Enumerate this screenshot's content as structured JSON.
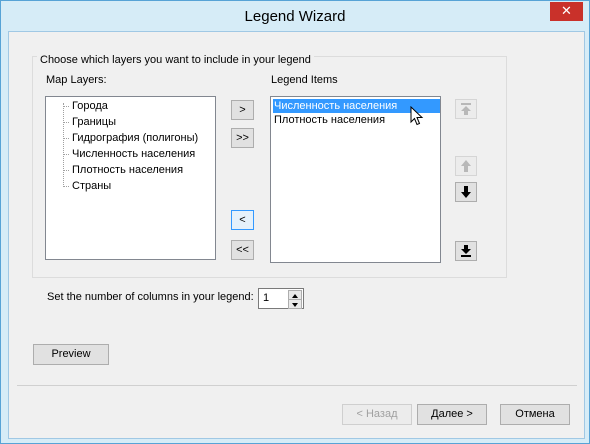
{
  "window": {
    "title": "Legend Wizard",
    "close_glyph": "✕"
  },
  "group": {
    "title": "Choose which layers you want to include in your legend"
  },
  "map_layers": {
    "label": "Map Layers:",
    "items": [
      "Города",
      "Границы",
      "Гидрография (полигоны)",
      "Численность населения",
      "Плотность населения",
      "Страны"
    ]
  },
  "legend_items": {
    "label": "Legend Items",
    "items": [
      "Численность населения",
      "Плотность населения"
    ],
    "selected_index": 0
  },
  "move_buttons": {
    "add": ">",
    "add_all": ">>",
    "remove": "<",
    "remove_all": "<<"
  },
  "order_buttons": {
    "top_icon": "move-top-icon",
    "up_icon": "move-up-icon",
    "down_icon": "move-down-icon",
    "bottom_icon": "move-bottom-icon"
  },
  "columns": {
    "label": "Set the number of columns in your legend:",
    "value": "1"
  },
  "preview_label": "Preview",
  "footer": {
    "back": "< Назад",
    "next": "Далее >",
    "cancel": "Отмена"
  },
  "colors": {
    "accent": "#3399ff",
    "title_bg": "#d6ecf7",
    "close_bg": "#c9312a"
  }
}
